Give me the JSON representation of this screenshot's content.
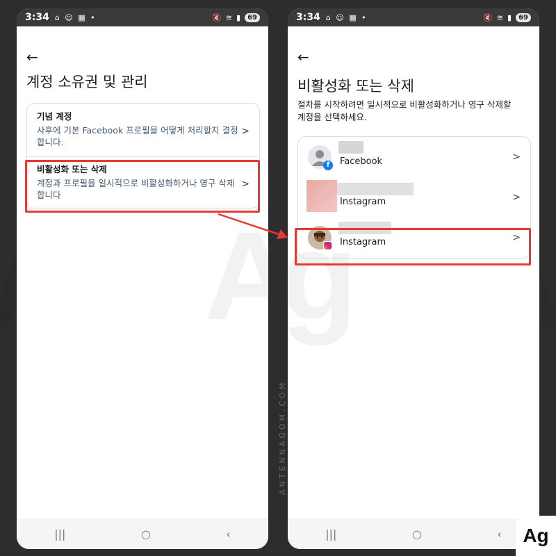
{
  "status_bar": {
    "time": "3:34",
    "notif_icons": "⌂ ☺ ▦ •",
    "battery": "69"
  },
  "left_screen": {
    "title": "계정 소유권 및 관리",
    "items": [
      {
        "title": "기념 계정",
        "subtitle": "사후에 기본 Facebook 프로필을 어떻게 처리할지 결정합니다."
      },
      {
        "title": "비활성화 또는 삭제",
        "subtitle": "계정과 프로필을 일시적으로 비활성화하거나 영구 삭제합니다"
      }
    ]
  },
  "right_screen": {
    "title": "비활성화 또는 삭제",
    "description": "절차를 시작하려면 일시적으로 비활성화하거나 영구 삭제할 계정을 선택하세요.",
    "accounts": [
      {
        "platform": "Facebook"
      },
      {
        "platform": "Instagram"
      },
      {
        "platform": "Instagram"
      }
    ]
  },
  "watermark": {
    "vertical_text": "ANTENNAGOM.COM",
    "logo": "Ag"
  },
  "colors": {
    "highlight": "#e53935",
    "arrow": "#e53935",
    "facebook": "#1877f2"
  }
}
